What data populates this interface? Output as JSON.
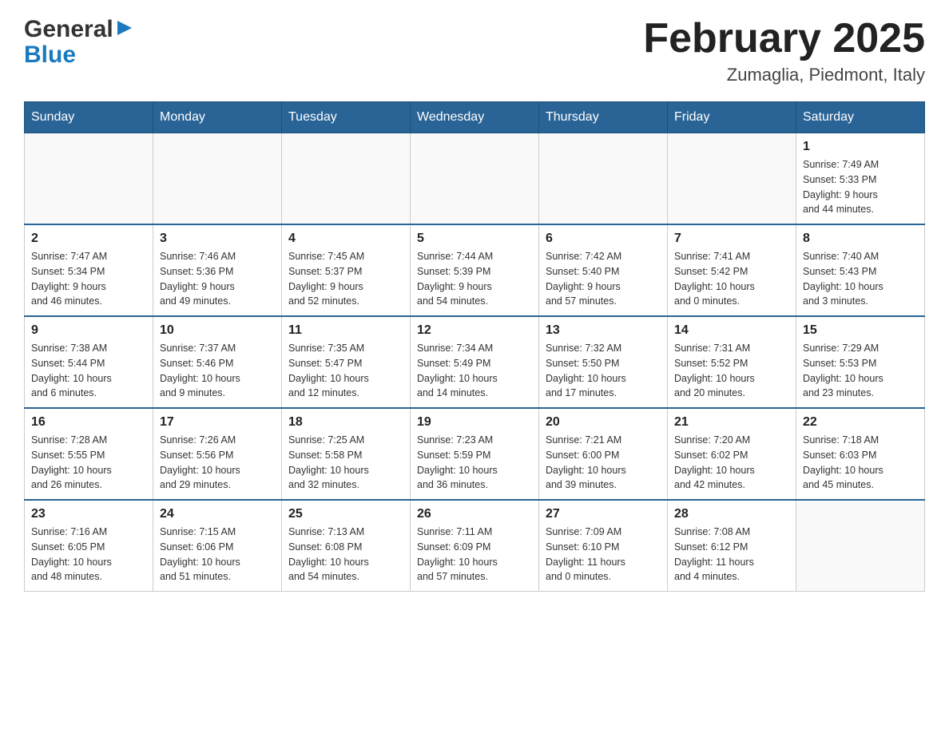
{
  "header": {
    "logo_general": "General",
    "logo_blue": "Blue",
    "title": "February 2025",
    "subtitle": "Zumaglia, Piedmont, Italy"
  },
  "calendar": {
    "days_of_week": [
      "Sunday",
      "Monday",
      "Tuesday",
      "Wednesday",
      "Thursday",
      "Friday",
      "Saturday"
    ],
    "weeks": [
      [
        {
          "day": "",
          "info": ""
        },
        {
          "day": "",
          "info": ""
        },
        {
          "day": "",
          "info": ""
        },
        {
          "day": "",
          "info": ""
        },
        {
          "day": "",
          "info": ""
        },
        {
          "day": "",
          "info": ""
        },
        {
          "day": "1",
          "info": "Sunrise: 7:49 AM\nSunset: 5:33 PM\nDaylight: 9 hours\nand 44 minutes."
        }
      ],
      [
        {
          "day": "2",
          "info": "Sunrise: 7:47 AM\nSunset: 5:34 PM\nDaylight: 9 hours\nand 46 minutes."
        },
        {
          "day": "3",
          "info": "Sunrise: 7:46 AM\nSunset: 5:36 PM\nDaylight: 9 hours\nand 49 minutes."
        },
        {
          "day": "4",
          "info": "Sunrise: 7:45 AM\nSunset: 5:37 PM\nDaylight: 9 hours\nand 52 minutes."
        },
        {
          "day": "5",
          "info": "Sunrise: 7:44 AM\nSunset: 5:39 PM\nDaylight: 9 hours\nand 54 minutes."
        },
        {
          "day": "6",
          "info": "Sunrise: 7:42 AM\nSunset: 5:40 PM\nDaylight: 9 hours\nand 57 minutes."
        },
        {
          "day": "7",
          "info": "Sunrise: 7:41 AM\nSunset: 5:42 PM\nDaylight: 10 hours\nand 0 minutes."
        },
        {
          "day": "8",
          "info": "Sunrise: 7:40 AM\nSunset: 5:43 PM\nDaylight: 10 hours\nand 3 minutes."
        }
      ],
      [
        {
          "day": "9",
          "info": "Sunrise: 7:38 AM\nSunset: 5:44 PM\nDaylight: 10 hours\nand 6 minutes."
        },
        {
          "day": "10",
          "info": "Sunrise: 7:37 AM\nSunset: 5:46 PM\nDaylight: 10 hours\nand 9 minutes."
        },
        {
          "day": "11",
          "info": "Sunrise: 7:35 AM\nSunset: 5:47 PM\nDaylight: 10 hours\nand 12 minutes."
        },
        {
          "day": "12",
          "info": "Sunrise: 7:34 AM\nSunset: 5:49 PM\nDaylight: 10 hours\nand 14 minutes."
        },
        {
          "day": "13",
          "info": "Sunrise: 7:32 AM\nSunset: 5:50 PM\nDaylight: 10 hours\nand 17 minutes."
        },
        {
          "day": "14",
          "info": "Sunrise: 7:31 AM\nSunset: 5:52 PM\nDaylight: 10 hours\nand 20 minutes."
        },
        {
          "day": "15",
          "info": "Sunrise: 7:29 AM\nSunset: 5:53 PM\nDaylight: 10 hours\nand 23 minutes."
        }
      ],
      [
        {
          "day": "16",
          "info": "Sunrise: 7:28 AM\nSunset: 5:55 PM\nDaylight: 10 hours\nand 26 minutes."
        },
        {
          "day": "17",
          "info": "Sunrise: 7:26 AM\nSunset: 5:56 PM\nDaylight: 10 hours\nand 29 minutes."
        },
        {
          "day": "18",
          "info": "Sunrise: 7:25 AM\nSunset: 5:58 PM\nDaylight: 10 hours\nand 32 minutes."
        },
        {
          "day": "19",
          "info": "Sunrise: 7:23 AM\nSunset: 5:59 PM\nDaylight: 10 hours\nand 36 minutes."
        },
        {
          "day": "20",
          "info": "Sunrise: 7:21 AM\nSunset: 6:00 PM\nDaylight: 10 hours\nand 39 minutes."
        },
        {
          "day": "21",
          "info": "Sunrise: 7:20 AM\nSunset: 6:02 PM\nDaylight: 10 hours\nand 42 minutes."
        },
        {
          "day": "22",
          "info": "Sunrise: 7:18 AM\nSunset: 6:03 PM\nDaylight: 10 hours\nand 45 minutes."
        }
      ],
      [
        {
          "day": "23",
          "info": "Sunrise: 7:16 AM\nSunset: 6:05 PM\nDaylight: 10 hours\nand 48 minutes."
        },
        {
          "day": "24",
          "info": "Sunrise: 7:15 AM\nSunset: 6:06 PM\nDaylight: 10 hours\nand 51 minutes."
        },
        {
          "day": "25",
          "info": "Sunrise: 7:13 AM\nSunset: 6:08 PM\nDaylight: 10 hours\nand 54 minutes."
        },
        {
          "day": "26",
          "info": "Sunrise: 7:11 AM\nSunset: 6:09 PM\nDaylight: 10 hours\nand 57 minutes."
        },
        {
          "day": "27",
          "info": "Sunrise: 7:09 AM\nSunset: 6:10 PM\nDaylight: 11 hours\nand 0 minutes."
        },
        {
          "day": "28",
          "info": "Sunrise: 7:08 AM\nSunset: 6:12 PM\nDaylight: 11 hours\nand 4 minutes."
        },
        {
          "day": "",
          "info": ""
        }
      ]
    ]
  }
}
